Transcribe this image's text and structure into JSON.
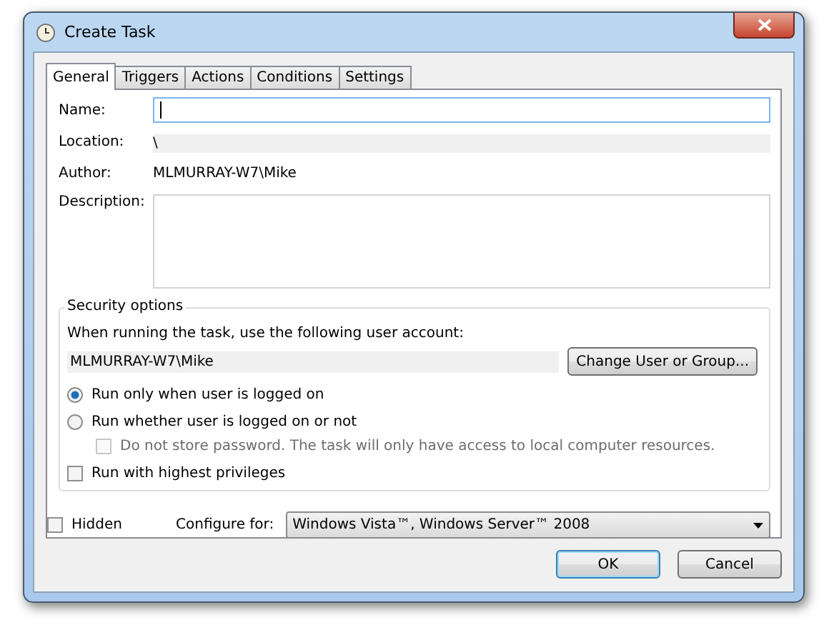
{
  "window": {
    "title": "Create Task"
  },
  "tabs": [
    {
      "label": "General",
      "selected": true
    },
    {
      "label": "Triggers",
      "selected": false
    },
    {
      "label": "Actions",
      "selected": false
    },
    {
      "label": "Conditions",
      "selected": false
    },
    {
      "label": "Settings",
      "selected": false
    }
  ],
  "general": {
    "name": {
      "label": "Name:"
    },
    "location": {
      "label": "Location:",
      "value": "\\"
    },
    "author": {
      "label": "Author:",
      "value": "MLMURRAY-W7\\Mike"
    },
    "description": {
      "label": "Description:"
    }
  },
  "security": {
    "title": "Security options",
    "account_prompt": "When running the task, use the following user account:",
    "account": "MLMURRAY-W7\\Mike",
    "change_button": "Change User or Group...",
    "options": [
      {
        "kind": "radio",
        "label": "Run only when user is logged on",
        "selected": true,
        "disabled": false,
        "indent": false
      },
      {
        "kind": "radio",
        "label": "Run whether user is logged on or not",
        "selected": false,
        "disabled": false,
        "indent": false
      },
      {
        "kind": "checkbox",
        "label": "Do not store password.  The task will only have access to local computer resources.",
        "checked": false,
        "disabled": true,
        "indent": true
      },
      {
        "kind": "checkbox",
        "label": "Run with highest privileges",
        "checked": false,
        "disabled": false,
        "indent": false
      }
    ]
  },
  "hidden": {
    "label": "Hidden",
    "checked": false
  },
  "configure": {
    "label": "Configure for:",
    "value": "Windows Vista™, Windows Server™ 2008"
  },
  "buttons": [
    {
      "label": "OK",
      "default": true
    },
    {
      "label": "Cancel",
      "default": false
    }
  ]
}
